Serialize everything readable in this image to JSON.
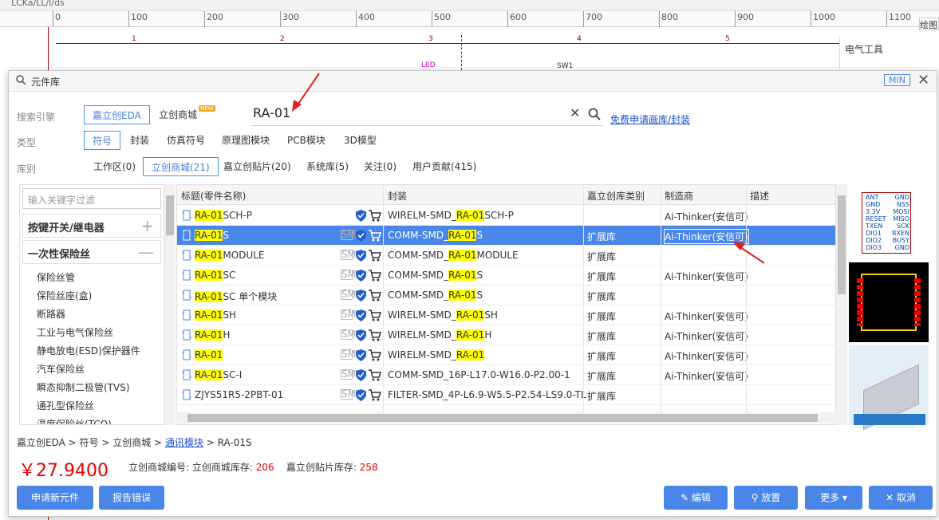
{
  "top": {
    "tab": "LCKa/LL/l/ds",
    "draw_btn": "绘图",
    "right_panel_title": "电气工具"
  },
  "ruler": {
    "labels": [
      "0",
      "100",
      "200",
      "300",
      "400",
      "500",
      "600",
      "700",
      "800",
      "900",
      "1000",
      "1100"
    ]
  },
  "schematic": {
    "cols": [
      "1",
      "2",
      "3",
      "4",
      "5"
    ],
    "led": "LED",
    "sw": "SW1"
  },
  "dialog": {
    "title": "元件库",
    "min": "MIN",
    "search_engine_label": "搜索引擎",
    "engines": [
      "嘉立创EDA",
      "立创商城"
    ],
    "new_badge": "NEW",
    "search_value": "RA-01",
    "apply_link": "免费申请画库/封装",
    "type_label": "类型",
    "types": [
      "符号",
      "封装",
      "仿真符号",
      "原理图模块",
      "PCB模块",
      "3D模型"
    ],
    "lib_label": "库别",
    "libs": [
      "工作区(0)",
      "立创商城(21)",
      "嘉立创贴片(20)",
      "系统库(5)",
      "关注(0)",
      "用户贡献(415)"
    ],
    "filter_placeholder": "输入关键字过滤",
    "tree": {
      "group1": "按键开关/继电器",
      "group2": "一次性保险丝",
      "leaves": [
        "保险丝管",
        "保险丝座(盒)",
        "断路器",
        "工业与电气保险丝",
        "静电放电(ESD)保护器件",
        "汽车保险丝",
        "瞬态抑制二极管(TVS)",
        "通孔型保险丝",
        "温度保险丝(TCO)"
      ]
    },
    "columns": [
      "标题(零件名称)",
      "封装",
      "嘉立创库类别",
      "制造商",
      "描述"
    ],
    "rows": [
      {
        "t_hl": "RA-01",
        "t": "SCH-P",
        "p1": "WIRELM-SMD_",
        "p_hl": "RA-01",
        "p2": "SCH-P",
        "cat": "",
        "mfr": "Ai-Thinker(安信可)",
        "smt": false
      },
      {
        "t_hl": "RA-01",
        "t": "S",
        "p1": "COMM-SMD_",
        "p_hl": "RA-01",
        "p2": "S",
        "cat": "扩展库",
        "mfr": "Ai-Thinker(安信可)",
        "smt": true,
        "sel": true
      },
      {
        "t_hl": "RA-01",
        "t": "MODULE",
        "p1": "COMM-SMD_",
        "p_hl": "RA-01",
        "p2": "MODULE",
        "cat": "扩展库",
        "mfr": "",
        "smt": true
      },
      {
        "t_hl": "RA-01",
        "t": "SC",
        "p1": "COMM-SMD_",
        "p_hl": "RA-01",
        "p2": "S",
        "cat": "扩展库",
        "mfr": "Ai-Thinker(安信可)",
        "smt": true
      },
      {
        "t_hl": "RA-01",
        "t": "SC 单个模块",
        "p1": "COMM-SMD_",
        "p_hl": "RA-01",
        "p2": "S",
        "cat": "扩展库",
        "mfr": "",
        "smt": true
      },
      {
        "t_hl": "RA-01",
        "t": "SH",
        "p1": "WIRELM-SMD_",
        "p_hl": "RA-01",
        "p2": "SH",
        "cat": "扩展库",
        "mfr": "Ai-Thinker(安信可)",
        "smt": true
      },
      {
        "t_hl": "RA-01",
        "t": "H",
        "p1": "WIRELM-SMD_",
        "p_hl": "RA-01",
        "p2": "H",
        "cat": "扩展库",
        "mfr": "Ai-Thinker(安信可)",
        "smt": true
      },
      {
        "t_hl": "RA-01",
        "t": "",
        "p1": "WIRELM-SMD_",
        "p_hl": "RA-01",
        "p2": "",
        "cat": "扩展库",
        "mfr": "Ai-Thinker(安信可)",
        "smt": true
      },
      {
        "t_hl": "RA-01",
        "t": "SC-I",
        "p1": "COMM-SMD_16P-L17.0-W16.0-P2.00-1",
        "p_hl": "",
        "p2": "",
        "cat": "扩展库",
        "mfr": "Ai-Thinker(安信可)",
        "smt": true
      },
      {
        "t_hl": "",
        "t": "ZJYS51R5-2PBT-01",
        "p1": "FILTER-SMD_4P-L6.9-W5.5-P2.54-LS9.0-TL",
        "p_hl": "",
        "p2": "",
        "cat": "扩展库",
        "mfr": "",
        "smt": true
      }
    ],
    "pins_left": [
      "ANT",
      "GND",
      "3.3V",
      "RESET",
      "TXEN",
      "DIO1",
      "DIO2",
      "DIO3"
    ],
    "pins_right": [
      "GND",
      "NSS",
      "MOSI",
      "MISO",
      "SCK",
      "RXEN",
      "BUSY",
      "GND"
    ],
    "breadcrumb": [
      "嘉立创EDA",
      "符号",
      "立创商城",
      "通讯模块",
      "RA-01S"
    ],
    "price": "￥27.9400",
    "stock": {
      "label1": "立创商城编号:",
      "label2": "立创商城库存:",
      "v2": "206",
      "label3": "嘉立创贴片库存:",
      "v3": "258"
    },
    "buttons": {
      "new": "申请新元件",
      "report": "报告错误",
      "edit": "编辑",
      "place": "放置",
      "more": "更多",
      "cancel": "取消"
    }
  }
}
